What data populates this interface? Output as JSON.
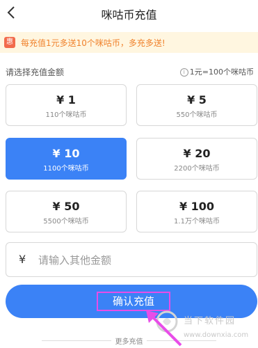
{
  "header": {
    "title": "咪咕币充值",
    "back_icon": "chevron-left-icon"
  },
  "promo": {
    "badge": "惠",
    "text": "每充值1元多送10个咪咕币，多充多送!",
    "color": "#f0822c"
  },
  "amount_section": {
    "label": "请选择充值金额",
    "rate": "1元=100个咪咕币",
    "info_icon": "info-icon"
  },
  "options": [
    {
      "amount": "¥ 1",
      "coins": "110个咪咕币",
      "selected": false
    },
    {
      "amount": "¥ 5",
      "coins": "550个咪咕币",
      "selected": false
    },
    {
      "amount": "¥ 10",
      "coins": "1100个咪咕币",
      "selected": true
    },
    {
      "amount": "¥ 20",
      "coins": "2200个咪咕币",
      "selected": false
    },
    {
      "amount": "¥ 50",
      "coins": "5500个咪咕币",
      "selected": false
    },
    {
      "amount": "¥ 100",
      "coins": "1.1万个咪咕币",
      "selected": false
    }
  ],
  "custom": {
    "symbol": "¥",
    "placeholder": "请输入其他金额",
    "value": ""
  },
  "confirm": {
    "label": "确认充值"
  },
  "more": {
    "label": "更多充值"
  },
  "watermark": {
    "text": "当下软件园",
    "url": "www.downxia.com"
  },
  "colors": {
    "accent": "#3b82f6",
    "highlight": "#e84de8",
    "promo_bg": "#fff6e0"
  }
}
